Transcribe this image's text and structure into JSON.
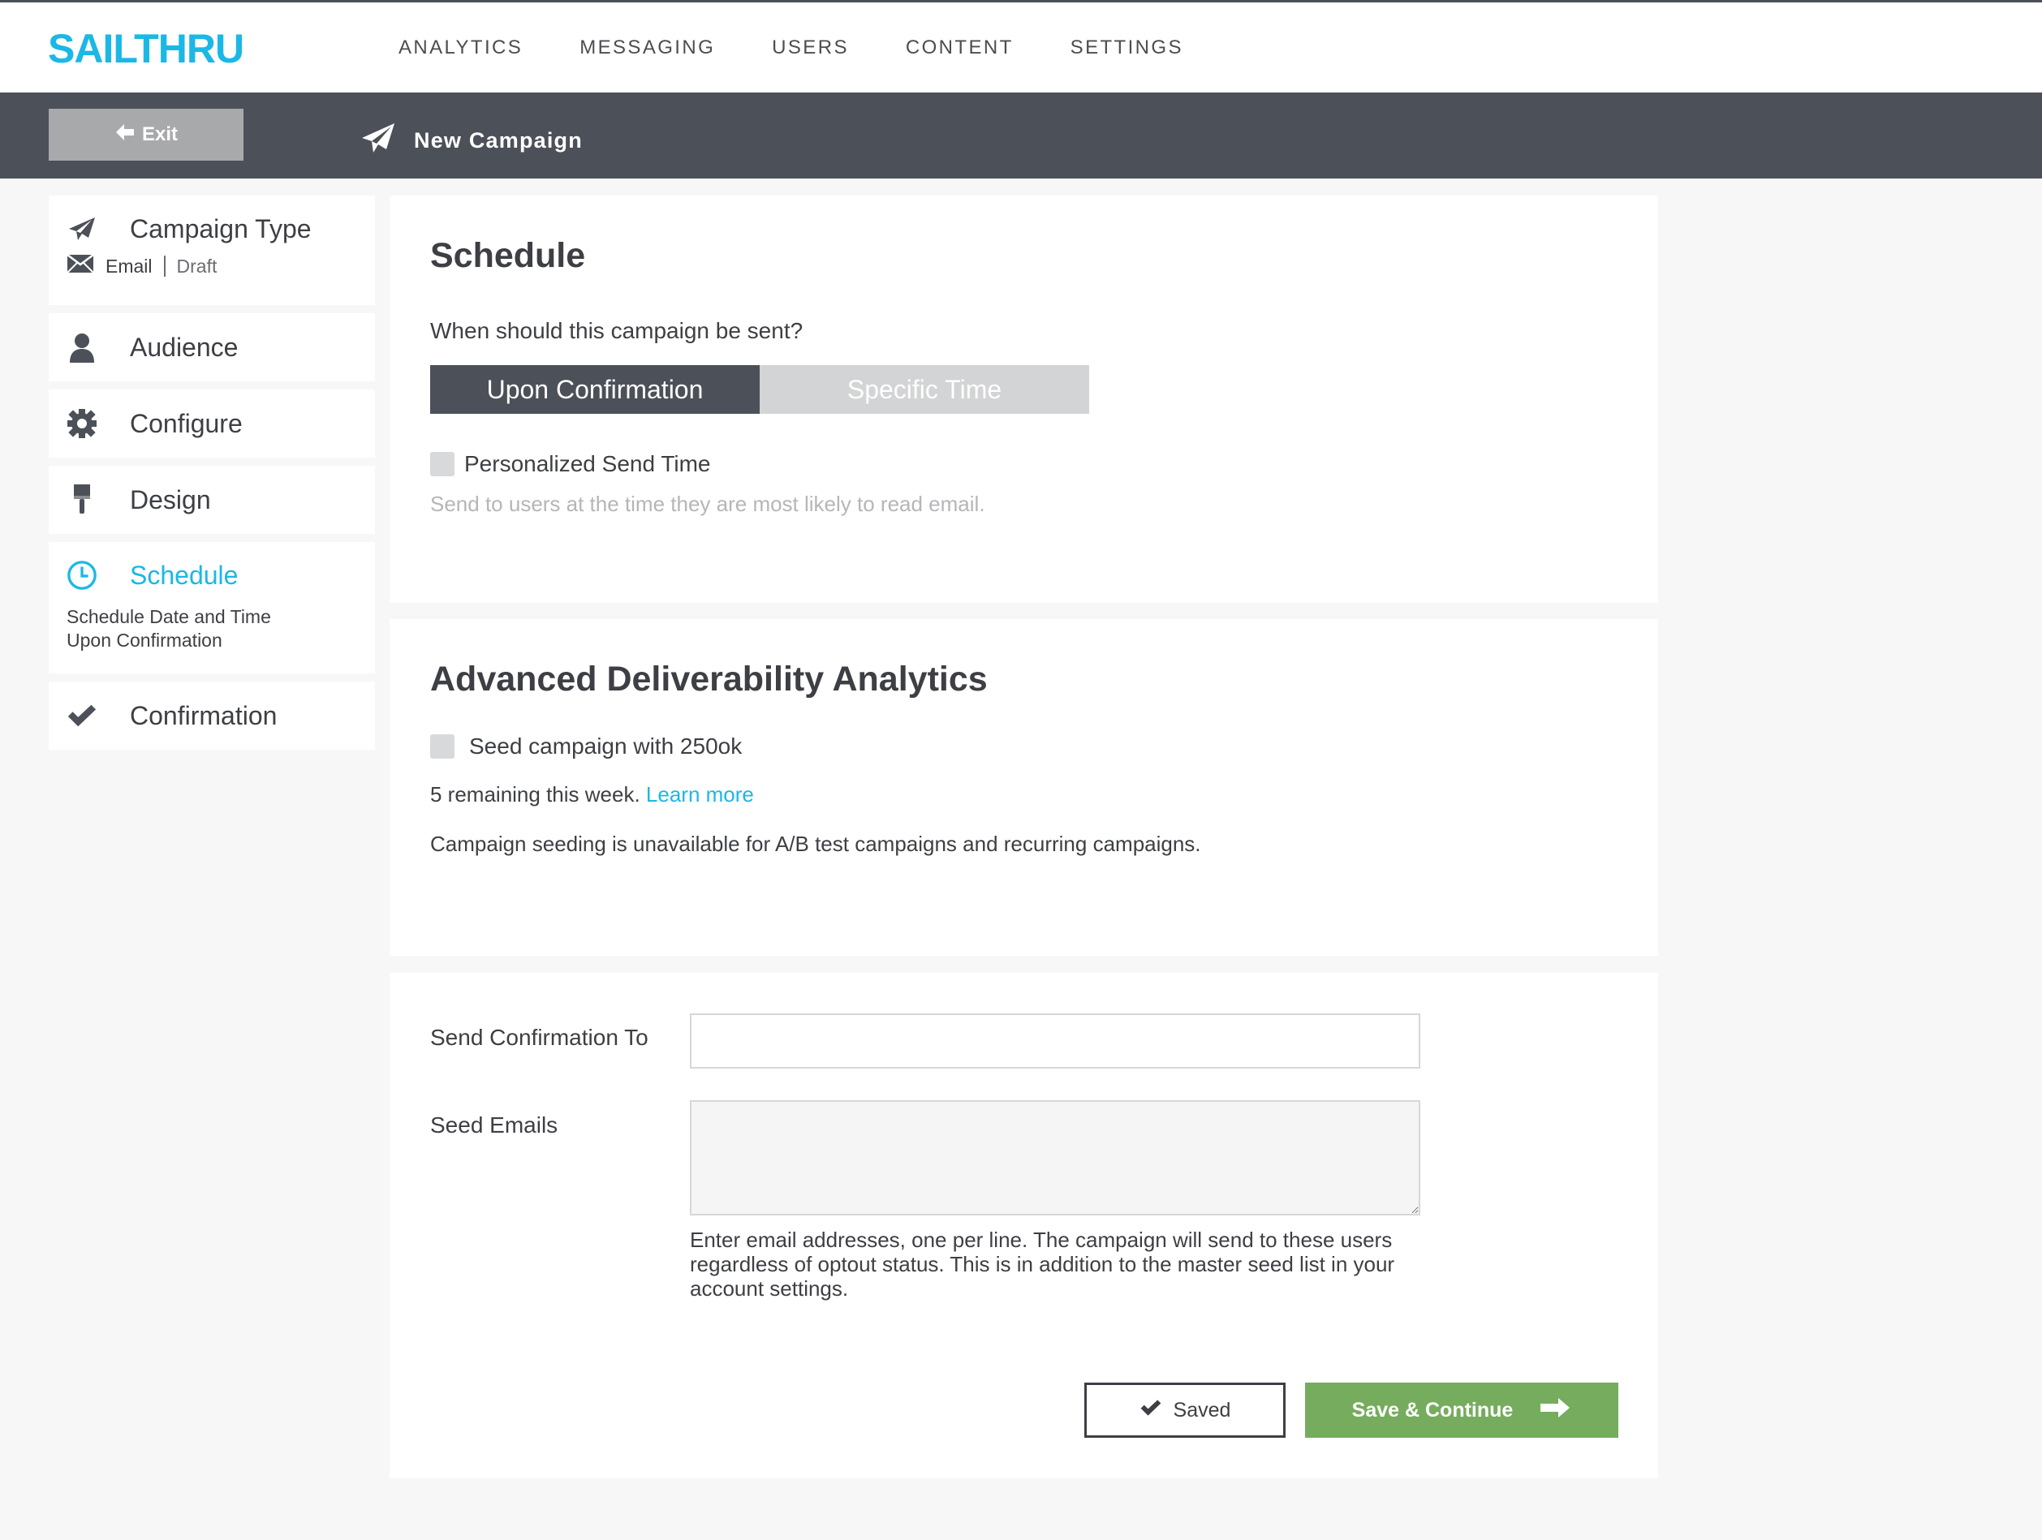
{
  "app": {
    "logo": "SAILTHRU"
  },
  "nav": [
    "ANALYTICS",
    "MESSAGING",
    "USERS",
    "CONTENT",
    "SETTINGS"
  ],
  "subbar": {
    "exit_label": "Exit",
    "title": "New Campaign"
  },
  "sidebar": {
    "campaign_type": {
      "label": "Campaign Type",
      "channel": "Email",
      "status": "Draft"
    },
    "audience": {
      "label": "Audience"
    },
    "configure": {
      "label": "Configure"
    },
    "design": {
      "label": "Design"
    },
    "schedule": {
      "label": "Schedule",
      "detail_title": "Schedule Date and Time",
      "detail_value": "Upon Confirmation"
    },
    "confirmation": {
      "label": "Confirmation"
    }
  },
  "schedule": {
    "title": "Schedule",
    "question": "When should this campaign be sent?",
    "option_confirmation": "Upon Confirmation",
    "option_specific": "Specific Time",
    "pst_label": "Personalized Send Time",
    "pst_help": "Send to users at the time they are most likely to read email."
  },
  "analytics": {
    "title": "Advanced Deliverability Analytics",
    "seed_label": "Seed campaign with 250ok",
    "remaining": "5 remaining this week.",
    "learn_more": "Learn more",
    "note": "Campaign seeding is unavailable for A/B test campaigns and recurring campaigns."
  },
  "form": {
    "confirm_label": "Send Confirmation To",
    "confirm_value": "",
    "seed_label": "Seed Emails",
    "seed_value": "",
    "seed_help": "Enter email addresses, one per line. The campaign will send to these users regardless of optout status. This is in addition to the master seed list in your account settings."
  },
  "actions": {
    "saved_label": "Saved",
    "continue_label": "Save & Continue"
  },
  "colors": {
    "brand": "#1bb8e5",
    "dark": "#4c5058",
    "continue": "#76ac5d"
  }
}
